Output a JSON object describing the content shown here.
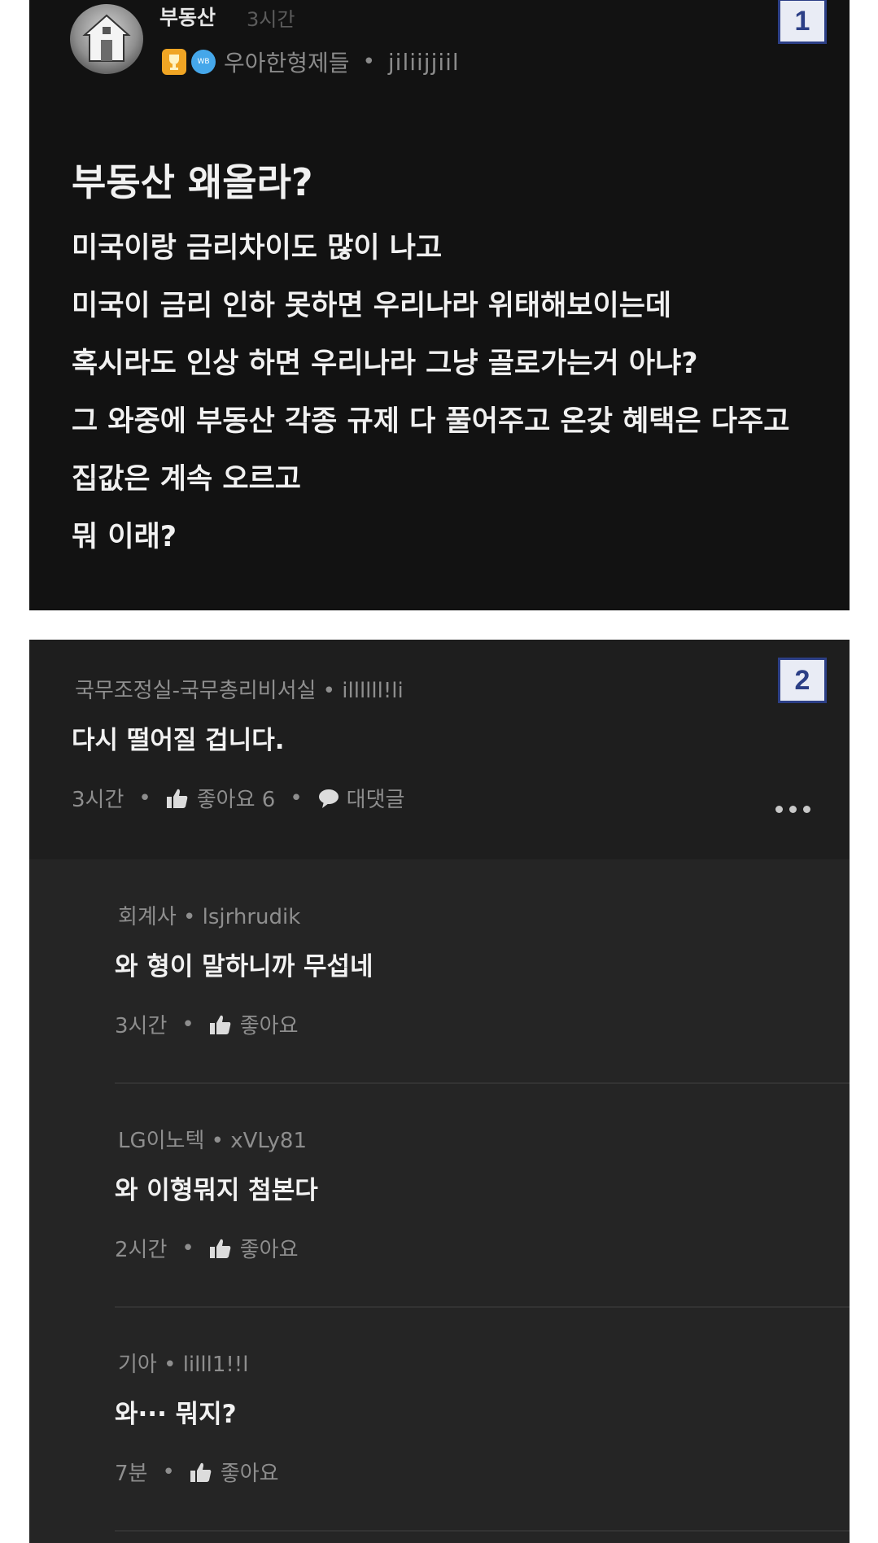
{
  "post": {
    "badge_number": "1",
    "author": "부동산",
    "time": "3시간",
    "group": "우아한형제들",
    "separator": "•",
    "user_id": "jiliijjiil",
    "title": "부동산 왜올라?",
    "body_lines": [
      "미국이랑 금리차이도 많이 나고",
      "미국이 금리 인하 못하면 우리나라 위태해보이는데",
      "혹시라도 인상 하면 우리나라 그냥 골로가는거 아냐?",
      "그 와중에 부동산 각종 규제 다 풀어주고 온갖 혜택은 다주고",
      "집값은 계속 오르고",
      "뭐 이래?"
    ]
  },
  "comments": {
    "badge_number": "2",
    "top": {
      "author": "국무조정실-국무총리비서실 • illllll!li",
      "text": "다시 떨어질 겁니다.",
      "time": "3시간",
      "separator": "•",
      "like_label": "좋아요 6",
      "reply_label": "대댓글"
    },
    "replies": [
      {
        "author": "회계사 • lsjrhrudik",
        "text": "와 형이 말하니까 무섭네",
        "time": "3시간",
        "separator": "•",
        "like_label": "좋아요"
      },
      {
        "author": "LG이노텍 • xVLy81",
        "text": "와 이형뭐지 첨본다",
        "time": "2시간",
        "separator": "•",
        "like_label": "좋아요"
      },
      {
        "author": "기아 • lilll1!!l",
        "text": "와··· 뭐지?",
        "time": "7분",
        "separator": "•",
        "like_label": "좋아요"
      }
    ]
  },
  "colors": {
    "post_bg": "#121212",
    "comment_bg": "#1e1e1e",
    "reply_bg": "#252525",
    "badge_border": "#2c3f86",
    "trophy": "#f0a524",
    "company_badge": "#45a7ea"
  },
  "icons": [
    "house-icon",
    "trophy-icon",
    "company-badge-icon",
    "thumbs-up-icon",
    "speech-bubble-icon",
    "more-options-icon"
  ]
}
